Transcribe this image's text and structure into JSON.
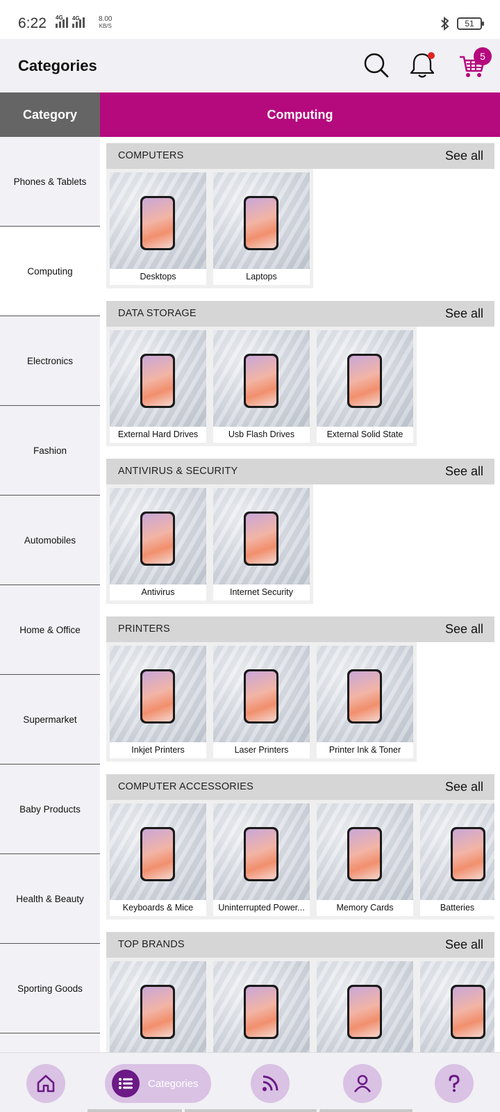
{
  "status_bar": {
    "time": "6:22",
    "network_speed": "8.00",
    "speed_unit": "KB/S",
    "network_1": "4G",
    "network_2": "4G",
    "battery": "51"
  },
  "header": {
    "title": "Categories",
    "cart_count": "5"
  },
  "tabs": {
    "category": "Category",
    "current": "Computing"
  },
  "sidebar": {
    "items": [
      {
        "label": "Phones & Tablets"
      },
      {
        "label": "Computing"
      },
      {
        "label": "Electronics"
      },
      {
        "label": "Fashion"
      },
      {
        "label": "Automobiles"
      },
      {
        "label": "Home & Office"
      },
      {
        "label": "Supermarket"
      },
      {
        "label": "Baby Products"
      },
      {
        "label": "Health & Beauty"
      },
      {
        "label": "Sporting Goods"
      }
    ],
    "active_index": 1
  },
  "sections": [
    {
      "title": "COMPUTERS",
      "see_all": "See all",
      "items": [
        "Desktops",
        "Laptops"
      ]
    },
    {
      "title": "DATA STORAGE",
      "see_all": "See all",
      "items": [
        "External Hard Drives",
        "Usb Flash Drives",
        "External Solid State"
      ]
    },
    {
      "title": "ANTIVIRUS & SECURITY",
      "see_all": "See all",
      "items": [
        "Antivirus",
        "Internet Security"
      ]
    },
    {
      "title": "PRINTERS",
      "see_all": "See all",
      "items": [
        "Inkjet Printers",
        "Laser Printers",
        "Printer Ink & Toner"
      ]
    },
    {
      "title": "COMPUTER ACCESSORIES",
      "see_all": "See all",
      "items": [
        "Keyboards & Mice",
        "Uninterrupted Power...",
        "Memory Cards",
        "Batteries"
      ]
    },
    {
      "title": "TOP BRANDS",
      "see_all": "See all",
      "items": [
        "",
        "",
        "",
        ""
      ]
    }
  ],
  "bottom_nav": {
    "active_label": "Categories",
    "icons": [
      "home-icon",
      "categories-icon",
      "feed-icon",
      "account-icon",
      "help-icon"
    ]
  },
  "colors": {
    "brand": "#b5097e",
    "tab_dark": "#656565",
    "nav_pill": "#d9c2e4",
    "nav_icon": "#6b1a86"
  }
}
